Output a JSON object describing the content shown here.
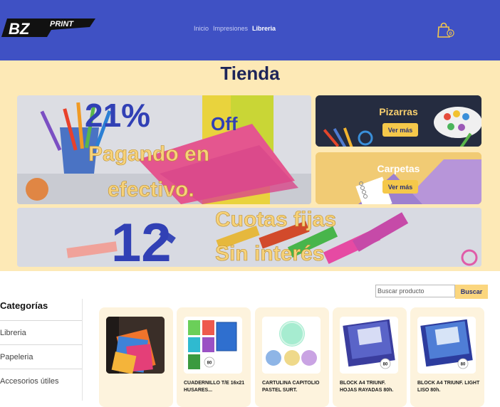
{
  "header": {
    "logo_text": "BZPRINT",
    "nav": [
      {
        "label": "Inicio",
        "active": false
      },
      {
        "label": "Impresiones",
        "active": false
      },
      {
        "label": "Libreria",
        "active": true
      }
    ],
    "cart_count": "0"
  },
  "hero": {
    "title": "Tienda",
    "promo_main": {
      "percent": "21%",
      "off": "Off",
      "line1": "Pagando en",
      "line2": "efectivo."
    },
    "promo_bottom": {
      "number": "12",
      "line1": "Cuotas fijas",
      "line2": "Sin interés"
    },
    "cards": [
      {
        "title": "Pizarras",
        "button": "Ver más"
      },
      {
        "title": "Carpetas",
        "button": "Ver más"
      }
    ]
  },
  "search": {
    "placeholder": "Buscar producto",
    "button": "Buscar"
  },
  "sidebar": {
    "title": "Categorías",
    "items": [
      "Libreria",
      "Papeleria",
      "Accesorios útiles"
    ]
  },
  "products": [
    {
      "name": ""
    },
    {
      "name": "CUADERNILLO T/E 16x21 HUSARES...",
      "badge": "80"
    },
    {
      "name": "CARTULINA CAPITOLIO PASTEL SURT."
    },
    {
      "name": "BLOCK A4 TRIUNF. HOJAS RAYADAS 80h.",
      "badge": "80"
    },
    {
      "name": "BLOCK A4 TRIUNF. LIGHT LISO 80h.",
      "badge": "80"
    }
  ],
  "colors": {
    "header": "#3f51c4",
    "hero_bg": "#fde9b6",
    "accent": "#f5c84a",
    "title": "#1d2559"
  }
}
